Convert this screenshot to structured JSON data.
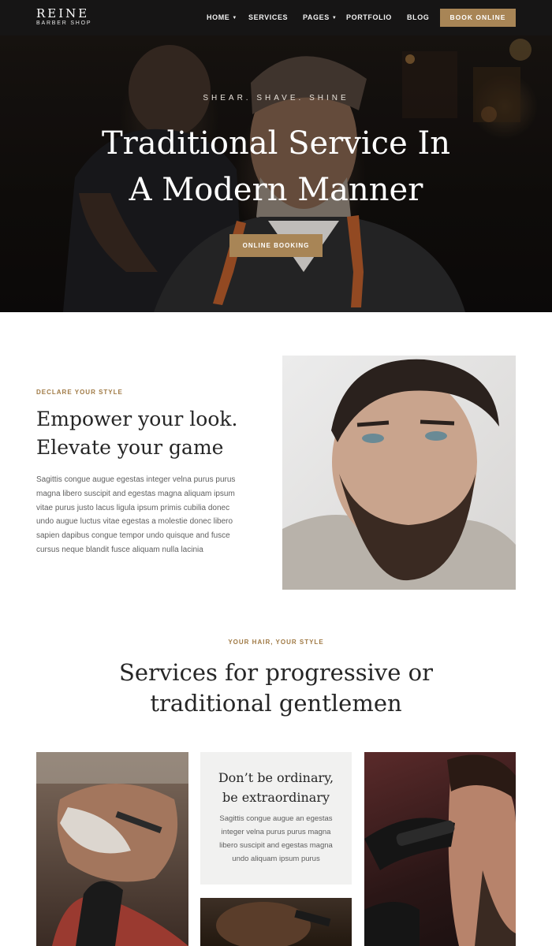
{
  "brand": {
    "name": "REINE",
    "tagline": "BARBER SHOP"
  },
  "nav": {
    "items": [
      {
        "label": "HOME",
        "has_dropdown": true
      },
      {
        "label": "SERVICES",
        "has_dropdown": false
      },
      {
        "label": "PAGES",
        "has_dropdown": true
      },
      {
        "label": "PORTFOLIO",
        "has_dropdown": false
      },
      {
        "label": "BLOG",
        "has_dropdown": false
      }
    ],
    "cta_label": "BOOK ONLINE",
    "caret_icon": "chevron-down-icon"
  },
  "hero": {
    "kicker": "SHEAR. SHAVE. SHINE",
    "title_line1": "Traditional Service In",
    "title_line2": "A Modern Manner",
    "button_label": "ONLINE BOOKING"
  },
  "about": {
    "kicker": "DECLARE YOUR STYLE",
    "title_line1": "Empower your look.",
    "title_line2": "Elevate your game",
    "text": "Sagittis congue augue egestas integer velna purus purus magna libero suscipit and egestas magna aliquam ipsum vitae purus justo lacus ligula ipsum primis cubilia donec undo augue luctus vitae egestas a molestie donec libero sapien dapibus congue tempor undo quisque and fusce cursus neque blandit fusce aliquam nulla lacinia"
  },
  "services": {
    "kicker": "YOUR HAIR, YOUR STYLE",
    "title_line1": "Services for progressive or",
    "title_line2": "traditional gentlemen",
    "card": {
      "title_line1": "Don’t be ordinary,",
      "title_line2": "be extraordinary",
      "text": "Sagittis congue augue an egestas integer velna purus purus magna libero suscipit and egestas magna undo aliquam ipsum purus"
    }
  },
  "colors": {
    "accent": "#a88556",
    "kicker": "#a07a45",
    "header_bg": "#161515",
    "card_bg": "#f1f1f0"
  }
}
